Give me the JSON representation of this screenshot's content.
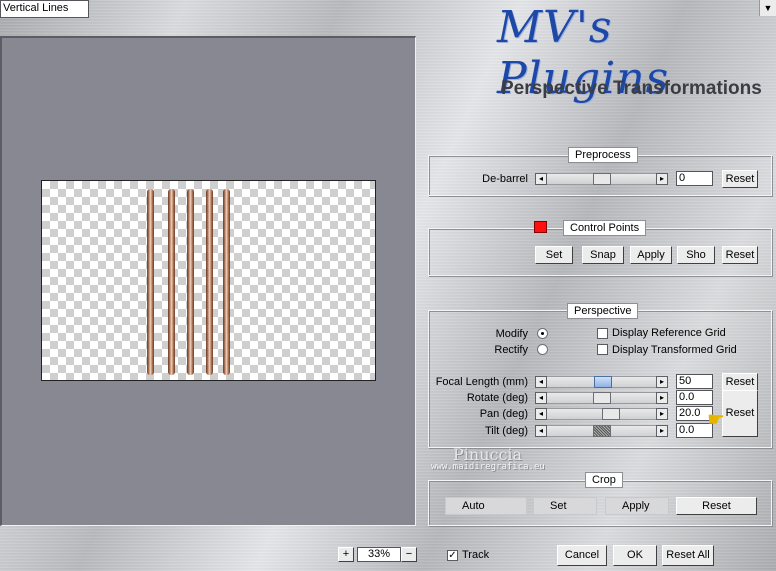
{
  "logo": {
    "script": "MV's Plugins",
    "subtitle": "Perspective Transformations"
  },
  "preprocess": {
    "title": "Preprocess",
    "debarrel_label": "De-barrel",
    "debarrel_value": "0",
    "debarrel_level": 0.5,
    "reset": "Reset"
  },
  "control_points": {
    "title": "Control Points",
    "swatch_color": "#ff1010",
    "line_type": "Vertical Lines",
    "set": "Set",
    "snap": "Snap",
    "apply": "Apply",
    "show": "Sho",
    "reset": "Reset"
  },
  "perspective": {
    "title": "Perspective",
    "modify": "Modify",
    "rectify": "Rectify",
    "display_reference_grid": "Display Reference Grid",
    "display_transformed_grid": "Display Transformed Grid",
    "focal_length_label": "Focal Length (mm)",
    "focal_length_value": "50",
    "rotate_label": "Rotate (deg)",
    "rotate_value": "0.0",
    "pan_label": "Pan (deg)",
    "pan_value": "20.0",
    "tilt_label": "Tilt (deg)",
    "tilt_value": "0.0",
    "reset_top": "Reset",
    "reset_big": "Reset"
  },
  "watermark": {
    "name": "Pinuccia",
    "url": "www.maidiregrafica.eu"
  },
  "crop": {
    "title": "Crop",
    "auto": "Auto",
    "set": "Set",
    "apply": "Apply",
    "reset": "Reset"
  },
  "bottom": {
    "zoom_in": "+",
    "zoom_value": "33%",
    "zoom_out": "−",
    "track_label": "Track",
    "cancel": "Cancel",
    "ok": "OK",
    "reset_all": "Reset All"
  }
}
